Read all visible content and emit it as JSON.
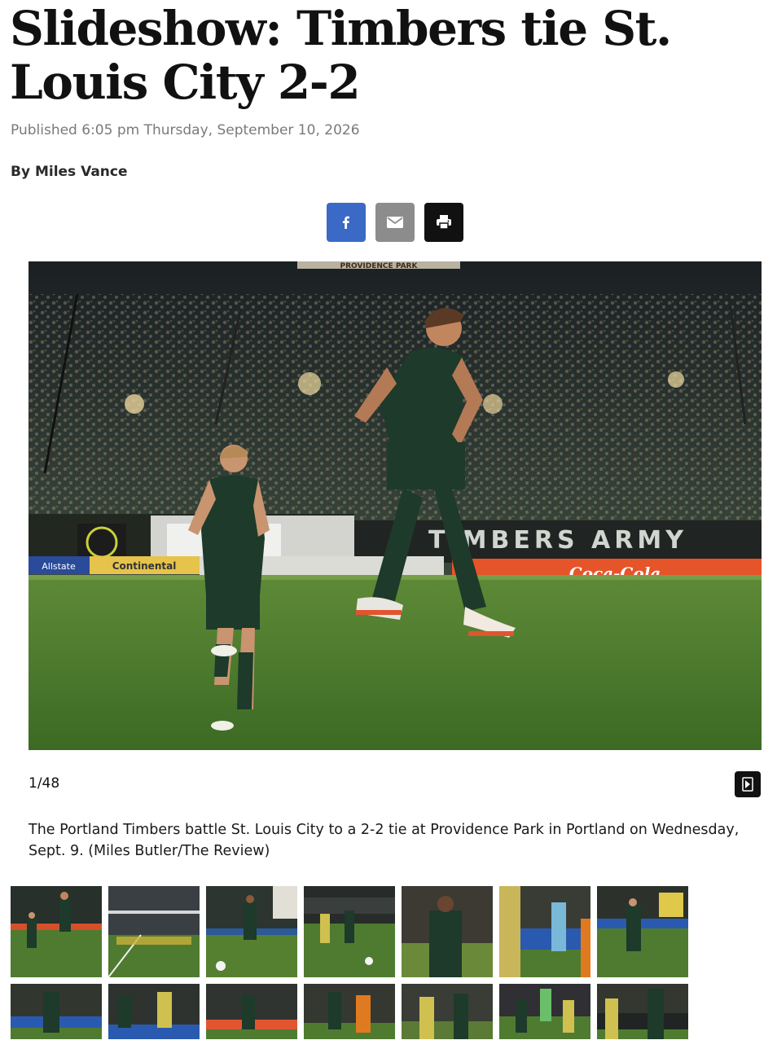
{
  "article": {
    "headline": "Slideshow: Timbers tie St. Louis City 2-2",
    "published": "Published 6:05 pm Thursday, September 10, 2026",
    "byline": "By Miles Vance"
  },
  "share": {
    "icons": [
      "facebook-icon",
      "mail-icon",
      "print-icon"
    ],
    "colors": {
      "facebook": "#3b6ac6",
      "mail": "#8c8c8c",
      "print": "#111111"
    }
  },
  "slideshow": {
    "counter": "1/48",
    "caption": "The Portland Timbers battle St. Louis City to a 2-2 tie at Providence Park in Portland on Wednesday, Sept. 9. (Miles Butler/The Review)",
    "banner_top": "PROVIDENCE PARK",
    "banner_army": "TIMBERS ARMY",
    "ad_left_1": "Allstate",
    "ad_left_2": "Continental",
    "ad_right": "Coca-Cola"
  }
}
